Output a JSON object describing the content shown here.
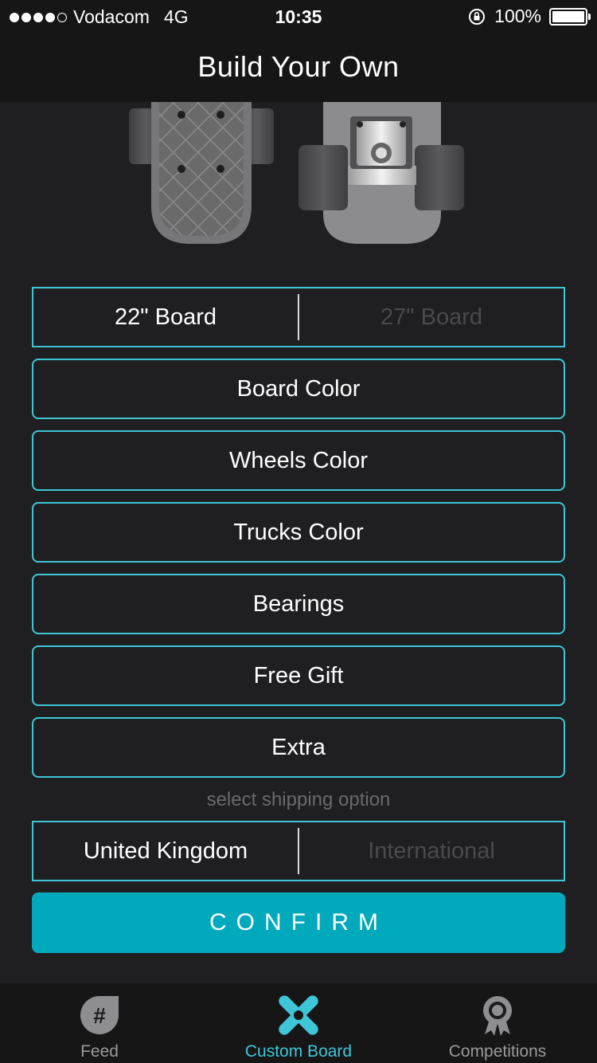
{
  "status_bar": {
    "carrier": "Vodacom",
    "network": "4G",
    "time": "10:35",
    "battery": "100%"
  },
  "header": {
    "title": "Build Your Own"
  },
  "board_size": {
    "options": [
      "22\" Board",
      "27\" Board"
    ],
    "selected": "22\" Board"
  },
  "options": [
    {
      "label": "Board Color"
    },
    {
      "label": "Wheels Color"
    },
    {
      "label": "Trucks Color"
    },
    {
      "label": "Bearings"
    },
    {
      "label": "Free Gift"
    },
    {
      "label": "Extra"
    }
  ],
  "shipping": {
    "label": "select shipping option",
    "options": [
      "United Kingdom",
      "International"
    ],
    "selected": "United Kingdom"
  },
  "confirm_label": "CONFIRM",
  "tabs": [
    {
      "label": "Feed",
      "icon": "hashtag-icon"
    },
    {
      "label": "Custom Board",
      "icon": "crossed-boards-icon",
      "active": true
    },
    {
      "label": "Competitions",
      "icon": "award-ribbon-icon"
    }
  ],
  "colors": {
    "accent": "#3ec6d8",
    "confirm": "#00a9bc",
    "background": "#1f1f21"
  }
}
